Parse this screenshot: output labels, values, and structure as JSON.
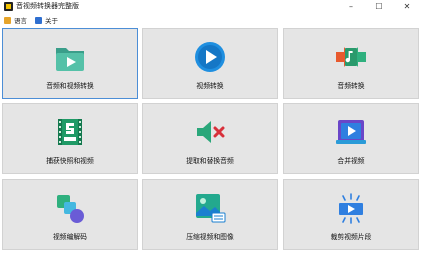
{
  "window": {
    "title": "音视频转换器完整版",
    "controls": {
      "minimize": "–",
      "maximize": "☐",
      "close": "✕"
    }
  },
  "menu": [
    {
      "label": "语言",
      "icon": "language-icon"
    },
    {
      "label": "关于",
      "icon": "info-icon"
    }
  ],
  "tiles": [
    {
      "label": "音频和视频转换",
      "icon": "folder-video-icon",
      "selected": true
    },
    {
      "label": "视频转换",
      "icon": "play-circle-icon",
      "selected": false
    },
    {
      "label": "音频转换",
      "icon": "audio-convert-icon",
      "selected": false
    },
    {
      "label": "捕获快照和视频",
      "icon": "film-5min-icon",
      "selected": false
    },
    {
      "label": "提取和替换音频",
      "icon": "speaker-mute-icon",
      "selected": false
    },
    {
      "label": "合并视频",
      "icon": "merge-video-icon",
      "selected": false
    },
    {
      "label": "视频编解码",
      "icon": "codec-shapes-icon",
      "selected": false
    },
    {
      "label": "压缩视频和图像",
      "icon": "compress-image-icon",
      "selected": false
    },
    {
      "label": "裁剪视频片段",
      "icon": "trim-video-icon",
      "selected": false
    }
  ]
}
